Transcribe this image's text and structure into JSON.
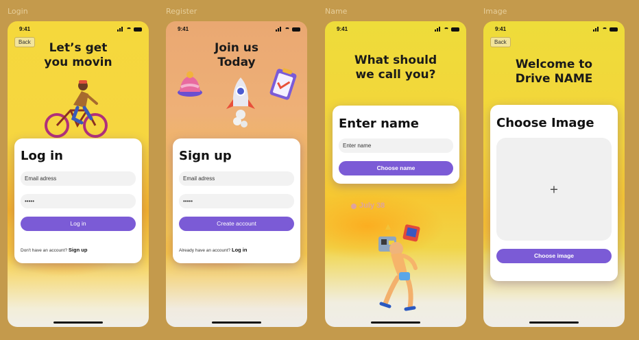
{
  "frames": {
    "login": {
      "label": "Login",
      "time": "9:41",
      "back": "Back",
      "headline_1": "Let’s get",
      "headline_2": "you movin",
      "card_title": "Log in",
      "email_placeholder": "Email adress",
      "password_value": "•••••",
      "button": "Log in",
      "foot_prefix": "Don't have an account?",
      "foot_link": "Sign up"
    },
    "register": {
      "label": "Register",
      "time": "9:41",
      "headline_1": "Join us",
      "headline_2": "Today",
      "card_title": "Sign up",
      "email_placeholder": "Email adress",
      "password_value": "•••••",
      "button": "Create account",
      "foot_prefix": "Already have an account?",
      "foot_link": "Log in"
    },
    "name": {
      "label": "Name",
      "time": "9:41",
      "headline_1": "What should",
      "headline_2": "we call you?",
      "card_title": "Enter name",
      "name_placeholder": "Enter name",
      "button": "Choose name",
      "ghost_text": "July 38"
    },
    "image": {
      "label": "Image",
      "time": "9:41",
      "back": "Back",
      "headline_1": "Welcome to",
      "headline_2": "Drive NAME",
      "card_title": "Choose Image",
      "plus": "+",
      "button": "Choose image"
    }
  },
  "colors": {
    "primary": "#7b5bd6",
    "background": "#c49a4c"
  }
}
